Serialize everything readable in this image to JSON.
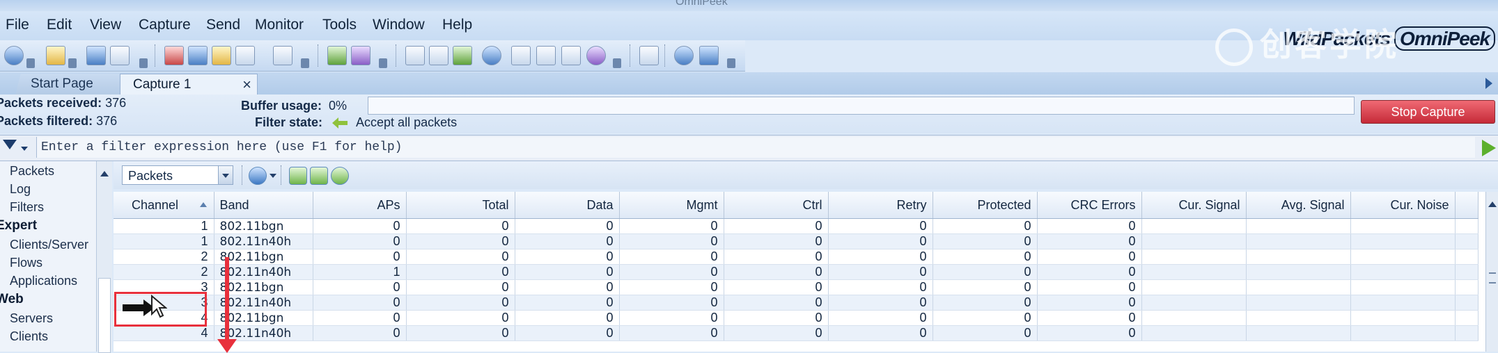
{
  "window": {
    "title": "OmniPeek"
  },
  "menu": [
    "File",
    "Edit",
    "View",
    "Capture",
    "Send",
    "Monitor",
    "Tools",
    "Window",
    "Help"
  ],
  "brand": {
    "left": "WildPackets",
    "right": "OmniPeek"
  },
  "watermark": "创客学院",
  "tabs": [
    {
      "label": "Start Page",
      "active": false
    },
    {
      "label": "Capture 1",
      "active": true,
      "close": "×"
    }
  ],
  "stats": {
    "packets_received_label": "Packets received:",
    "packets_received": "376",
    "packets_filtered_label": "Packets filtered:",
    "packets_filtered": "376",
    "buffer_usage_label": "Buffer usage:",
    "buffer_usage": "0%",
    "buffer_fraction": 0.0,
    "filter_state_label": "Filter state:",
    "filter_state": "Accept all packets",
    "stop_capture": "Stop Capture"
  },
  "filter": {
    "placeholder": "Enter a filter expression here (use F1 for help)"
  },
  "leftnav": {
    "items": [
      {
        "label": "Packets",
        "group": false
      },
      {
        "label": "Log",
        "group": false
      },
      {
        "label": "Filters",
        "group": false
      },
      {
        "label": "Expert",
        "group": true
      },
      {
        "label": "Clients/Server",
        "group": false
      },
      {
        "label": "Flows",
        "group": false
      },
      {
        "label": "Applications",
        "group": false
      },
      {
        "label": "Web",
        "group": true
      },
      {
        "label": "Servers",
        "group": false
      },
      {
        "label": "Clients",
        "group": false
      }
    ]
  },
  "view": {
    "selected": "Packets"
  },
  "table": {
    "columns": [
      "Channel",
      "Band",
      "APs",
      "Total",
      "Data",
      "Mgmt",
      "Ctrl",
      "Retry",
      "Protected",
      "CRC Errors",
      "Cur. Signal",
      "Avg. Signal",
      "Cur. Noise"
    ],
    "rows": [
      [
        "1",
        "802.11bgn",
        "0",
        "0",
        "0",
        "0",
        "0",
        "0",
        "0",
        "0",
        "",
        "",
        ""
      ],
      [
        "1",
        "802.11n40h",
        "0",
        "0",
        "0",
        "0",
        "0",
        "0",
        "0",
        "0",
        "",
        "",
        ""
      ],
      [
        "2",
        "802.11bgn",
        "0",
        "0",
        "0",
        "0",
        "0",
        "0",
        "0",
        "0",
        "",
        "",
        ""
      ],
      [
        "2",
        "802.11n40h",
        "1",
        "0",
        "0",
        "0",
        "0",
        "0",
        "0",
        "0",
        "",
        "",
        ""
      ],
      [
        "3",
        "802.11bgn",
        "0",
        "0",
        "0",
        "0",
        "0",
        "0",
        "0",
        "0",
        "",
        "",
        ""
      ],
      [
        "3",
        "802.11n40h",
        "0",
        "0",
        "0",
        "0",
        "0",
        "0",
        "0",
        "0",
        "",
        "",
        ""
      ],
      [
        "4",
        "802.11bgn",
        "0",
        "0",
        "0",
        "0",
        "0",
        "0",
        "0",
        "0",
        "",
        "",
        ""
      ],
      [
        "4",
        "802.11n40h",
        "0",
        "0",
        "0",
        "0",
        "0",
        "0",
        "0",
        "0",
        "",
        "",
        ""
      ]
    ]
  },
  "colors": {
    "stop_capture": "#d23a47",
    "accent": "#2b5a9a",
    "annotation": "#e8303c"
  }
}
